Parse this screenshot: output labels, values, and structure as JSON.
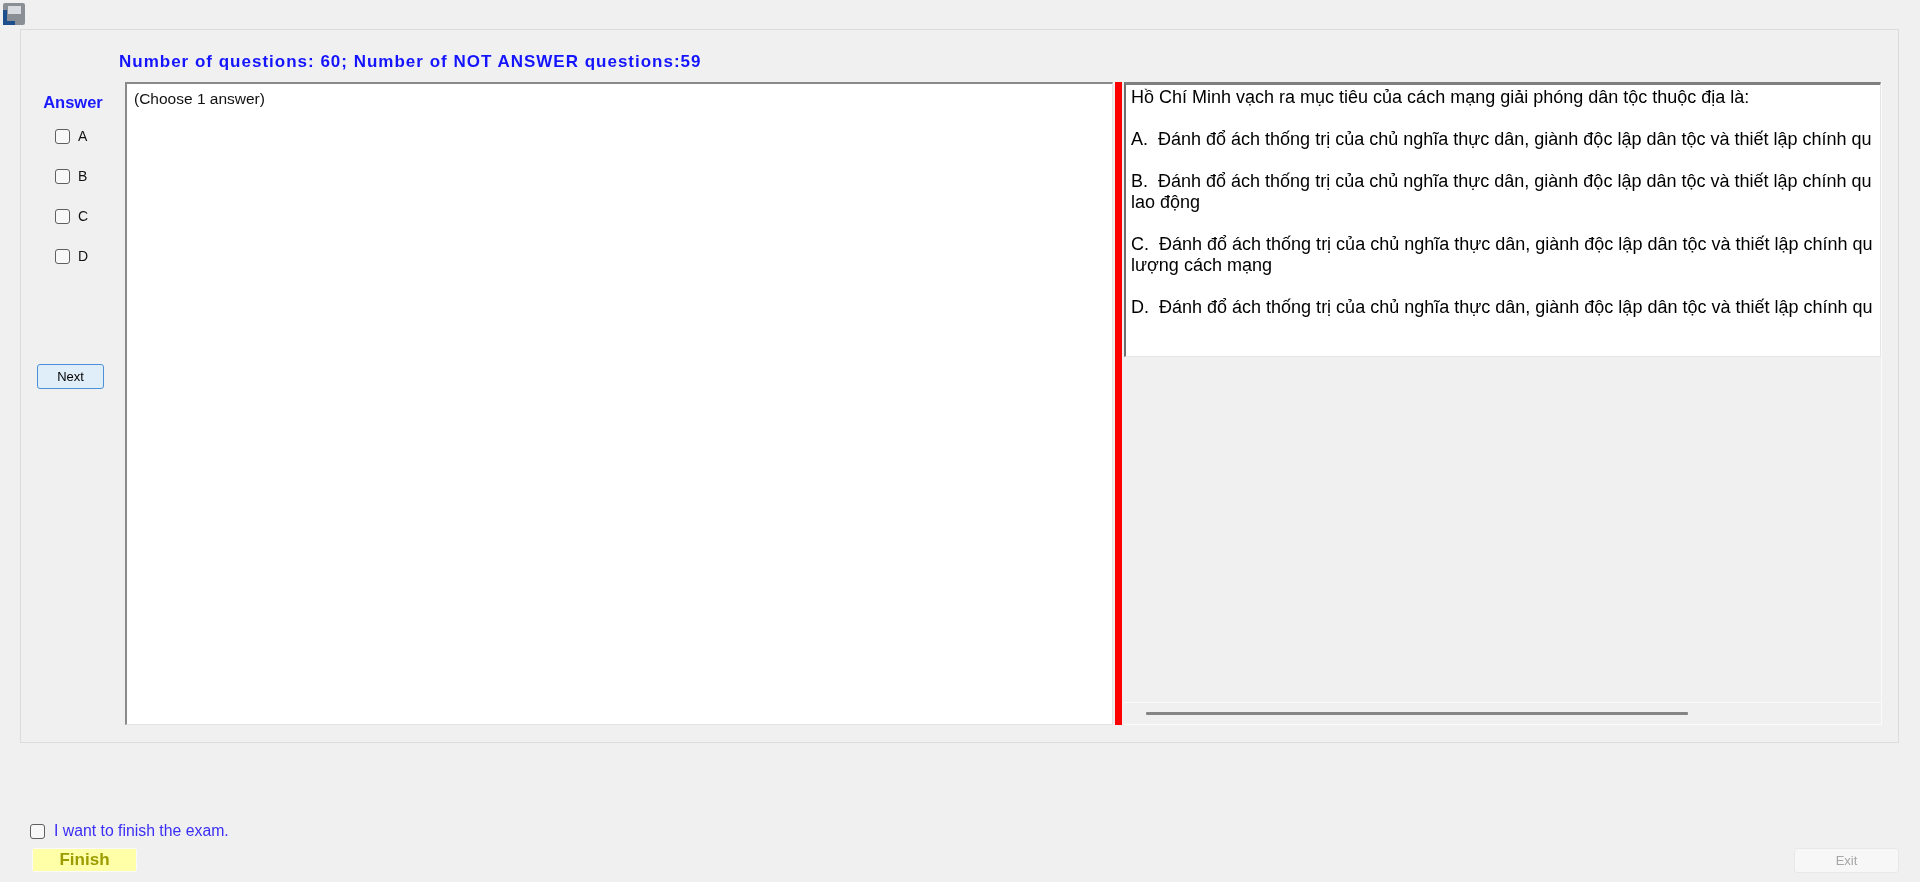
{
  "header": {
    "text": "Number of questions: 60; Number of NOT ANSWER questions:59"
  },
  "answer_panel": {
    "title": "Answer",
    "options": [
      {
        "label": "A",
        "checked": false
      },
      {
        "label": "B",
        "checked": false
      },
      {
        "label": "C",
        "checked": false
      },
      {
        "label": "D",
        "checked": false
      }
    ],
    "next_button": {
      "label": "Next"
    }
  },
  "answer_box": {
    "instruction": "(Choose 1 answer)"
  },
  "question": {
    "stem": "Hồ Chí Minh vạch ra mục tiêu của cách mạng giải phóng dân tộc thuộc địa là:",
    "options": [
      {
        "lines": [
          "A.  Đánh đổ ách thống trị của chủ nghĩa thực dân, giành độc lập dân tộc và thiết lập chính qu"
        ]
      },
      {
        "lines": [
          "B.  Đánh đổ ách thống trị của chủ nghĩa thực dân, giành độc lập dân tộc và thiết lập chính qu",
          "lao động"
        ]
      },
      {
        "lines": [
          "C.  Đánh đổ ách thống trị của chủ nghĩa thực dân, giành độc lập dân tộc và thiết lập chính qu",
          "lượng cách mạng"
        ]
      },
      {
        "lines": [
          "D.  Đánh đổ ách thống trị của chủ nghĩa thực dân, giành độc lập dân tộc và thiết lập chính qu"
        ]
      }
    ]
  },
  "footer": {
    "finish_checkbox": {
      "label": "I want to finish the exam.",
      "checked": false
    },
    "finish_button": {
      "label": "Finish"
    },
    "exit_button": {
      "label": "Exit",
      "disabled": true
    }
  }
}
